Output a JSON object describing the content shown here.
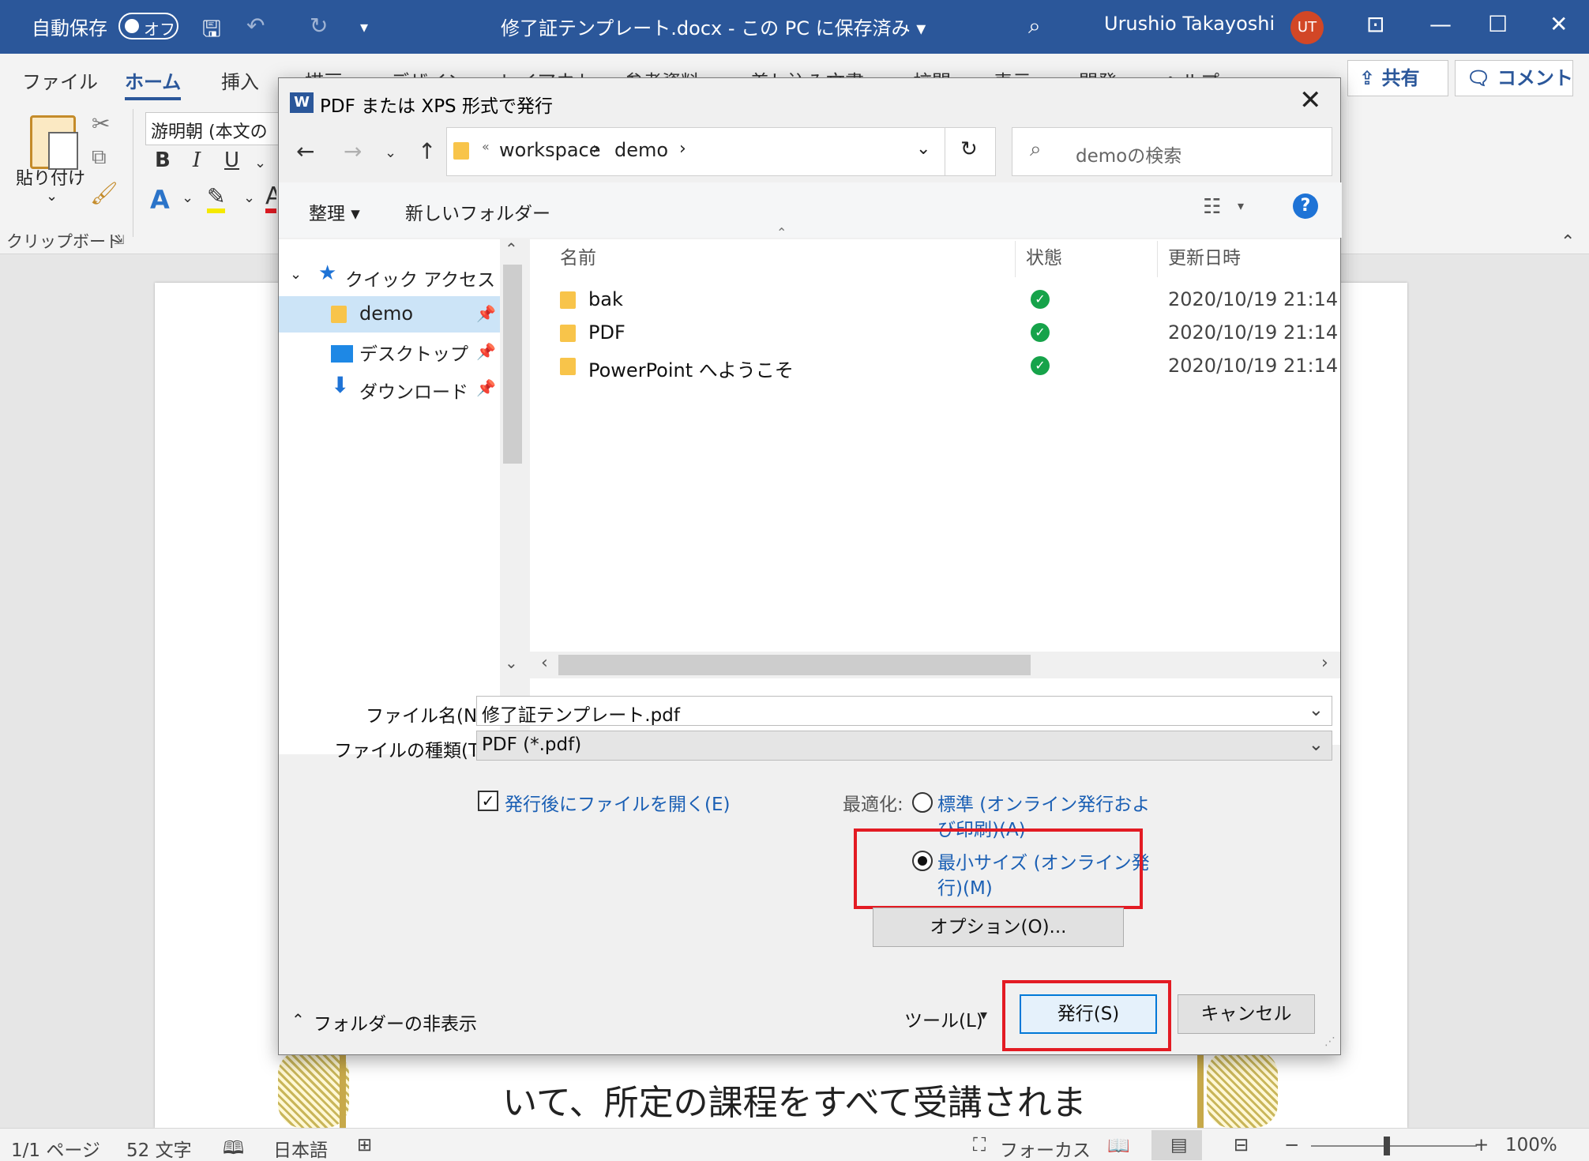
{
  "titlebar": {
    "autosave_label": "自動保存",
    "autosave_state": "オフ",
    "document_title": "修了証テンプレート.docx - この PC に保存済み ▾",
    "user_name": "Urushio Takayoshi",
    "user_initials": "UT"
  },
  "ribbon": {
    "tabs": [
      "ファイル",
      "ホーム",
      "挿入",
      "描画",
      "デザイン",
      "レイアウト",
      "参考資料",
      "差し込み文書",
      "校閲",
      "表示",
      "開発",
      "ヘルプ"
    ],
    "share_label": "共有",
    "comment_label": "コメント",
    "paste_label": "貼り付け",
    "font_name": "游明朝 (本文の",
    "group_clipboard": "クリップボード",
    "bold": "B",
    "italic": "I",
    "underline": "U"
  },
  "document": {
    "visible_text": "いて、所定の課程をすべて受講されま"
  },
  "statusbar": {
    "page": "1/1 ページ",
    "words": "52 文字",
    "language": "日本語",
    "focus": "フォーカス",
    "zoom": "100%"
  },
  "dialog": {
    "title": "PDF または XPS 形式で発行",
    "breadcrumb": [
      "«",
      "workspace",
      "demo"
    ],
    "search_placeholder": "demoの検索",
    "organize": "整理 ▾",
    "new_folder": "新しいフォルダー",
    "help": "?",
    "nav": {
      "quick_access": "クイック アクセス",
      "items": [
        {
          "label": "demo"
        },
        {
          "label": "デスクトップ"
        },
        {
          "label": "ダウンロード"
        }
      ]
    },
    "columns": {
      "name": "名前",
      "status": "状態",
      "modified": "更新日時"
    },
    "files": [
      {
        "name": "bak",
        "modified": "2020/10/19 21:14"
      },
      {
        "name": "PDF",
        "modified": "2020/10/19 21:14"
      },
      {
        "name": "PowerPoint へようこそ",
        "modified": "2020/10/19 21:14"
      }
    ],
    "filename_label": "ファイル名(N):",
    "filename_value": "修了証テンプレート.pdf",
    "filetype_label": "ファイルの種類(T):",
    "filetype_value": "PDF (*.pdf)",
    "open_after": "発行後にファイルを開く(E)",
    "optimize_label": "最適化:",
    "opt_standard_1": "標準 (オンライン発行およ",
    "opt_standard_2": "び印刷)(A)",
    "opt_min_1": "最小サイズ (オンライン発",
    "opt_min_2": "行)(M)",
    "options_button": "オプション(O)...",
    "hide_folders": "フォルダーの非表示",
    "tools": "ツール(L)",
    "publish": "発行(S)",
    "cancel": "キャンセル"
  },
  "colors": {
    "word_blue": "#2b579a",
    "highlight_red": "#e31b23",
    "link_blue": "#1a5fb4"
  }
}
